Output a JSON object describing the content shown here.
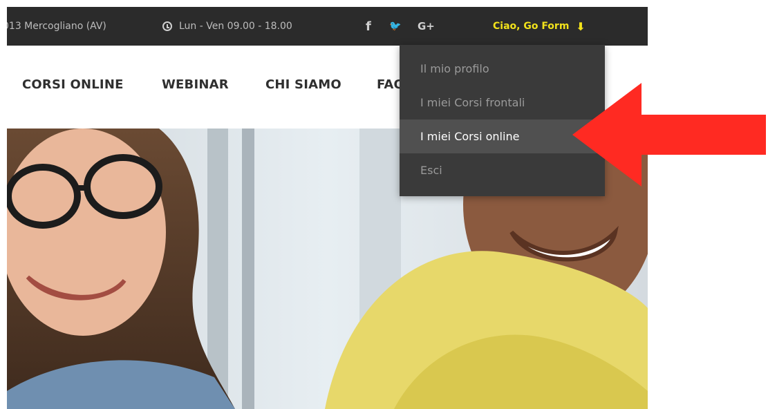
{
  "topbar": {
    "address": "013 Mercogliano (AV)",
    "hours": "Lun - Ven 09.00 - 18.00",
    "social": [
      {
        "label": "f",
        "icon": "facebook-icon"
      },
      {
        "label": "🐦",
        "icon": "twitter-icon"
      },
      {
        "label": "G+",
        "icon": "google-plus-icon"
      }
    ],
    "greeting": "Ciao, Go Form",
    "greeting_arrow": "⬇",
    "greeting_color": "#f2e21b",
    "background": "#2b2b2b"
  },
  "nav": {
    "items": [
      "CORSI ONLINE",
      "WEBINAR",
      "CHI SIAMO",
      "FAQ"
    ]
  },
  "dropdown": {
    "items": [
      {
        "label": "Il mio profilo"
      },
      {
        "label": "I miei Corsi frontali"
      },
      {
        "label": "I miei Corsi online"
      },
      {
        "label": "Esci"
      }
    ]
  },
  "annotation": {
    "color": "#ff2a22",
    "icon": "left-arrow-icon"
  }
}
